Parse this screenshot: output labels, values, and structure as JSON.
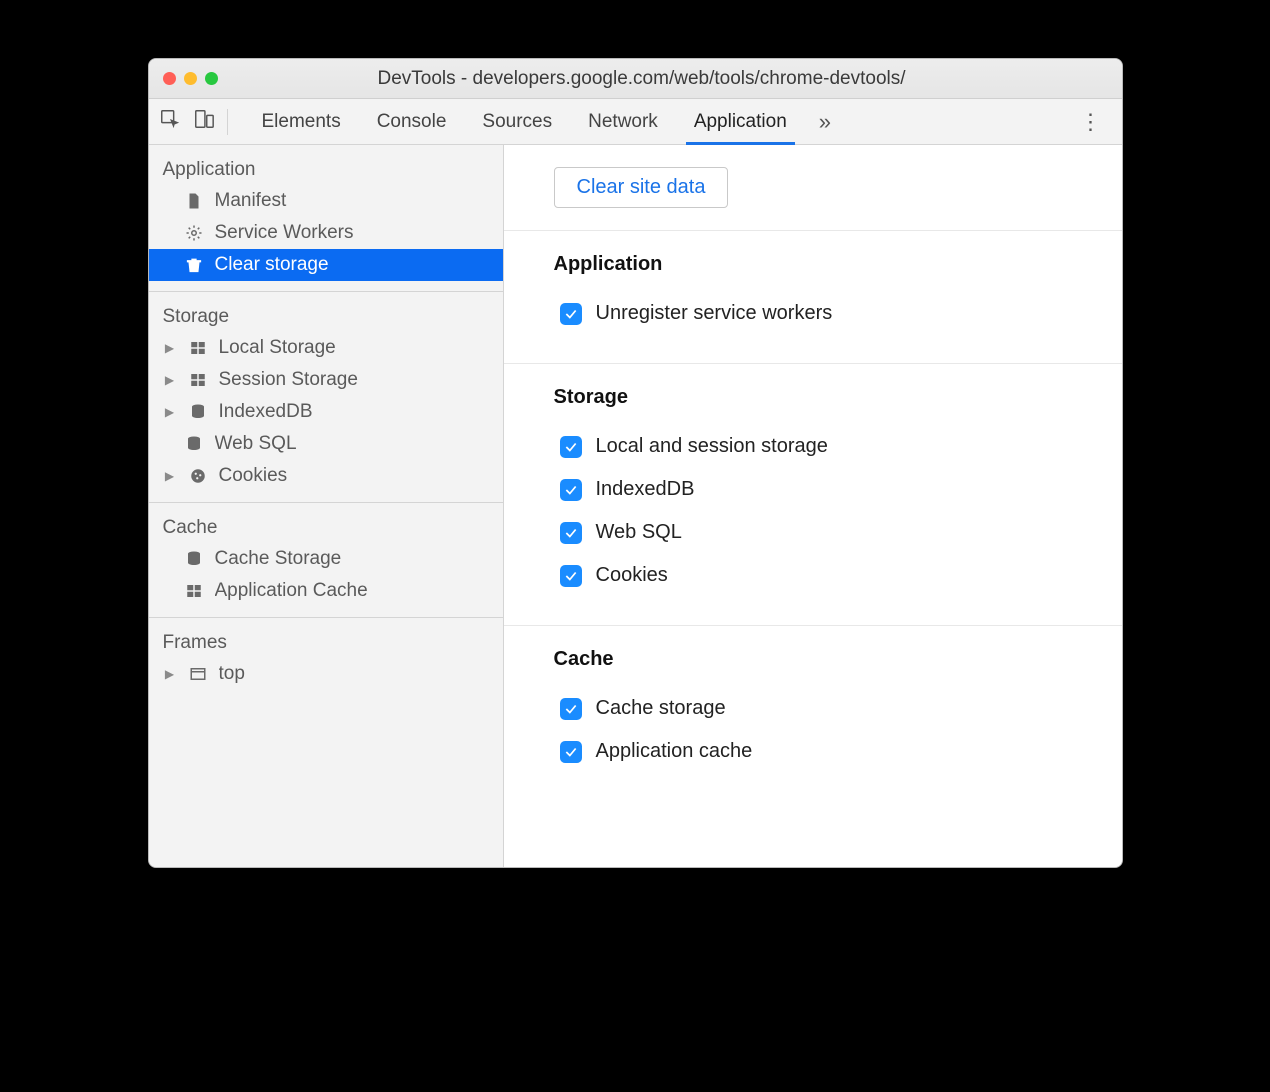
{
  "window": {
    "title": "DevTools - developers.google.com/web/tools/chrome-devtools/"
  },
  "toolbar": {
    "tabs": [
      "Elements",
      "Console",
      "Sources",
      "Network",
      "Application"
    ],
    "active_tab": "Application"
  },
  "sidebar": {
    "groups": [
      {
        "header": "Application",
        "items": [
          {
            "label": "Manifest",
            "icon": "file",
            "expandable": false,
            "selected": false
          },
          {
            "label": "Service Workers",
            "icon": "gear",
            "expandable": false,
            "selected": false
          },
          {
            "label": "Clear storage",
            "icon": "trash",
            "expandable": false,
            "selected": true
          }
        ]
      },
      {
        "header": "Storage",
        "items": [
          {
            "label": "Local Storage",
            "icon": "table",
            "expandable": true,
            "selected": false
          },
          {
            "label": "Session Storage",
            "icon": "table",
            "expandable": true,
            "selected": false
          },
          {
            "label": "IndexedDB",
            "icon": "db",
            "expandable": true,
            "selected": false
          },
          {
            "label": "Web SQL",
            "icon": "db",
            "expandable": false,
            "selected": false
          },
          {
            "label": "Cookies",
            "icon": "cookie",
            "expandable": true,
            "selected": false
          }
        ]
      },
      {
        "header": "Cache",
        "items": [
          {
            "label": "Cache Storage",
            "icon": "db",
            "expandable": false,
            "selected": false
          },
          {
            "label": "Application Cache",
            "icon": "table",
            "expandable": false,
            "selected": false
          }
        ]
      },
      {
        "header": "Frames",
        "items": [
          {
            "label": "top",
            "icon": "frame",
            "expandable": true,
            "selected": false
          }
        ]
      }
    ]
  },
  "content": {
    "clear_button": "Clear site data",
    "sections": [
      {
        "title": "Application",
        "checks": [
          {
            "label": "Unregister service workers",
            "checked": true
          }
        ]
      },
      {
        "title": "Storage",
        "checks": [
          {
            "label": "Local and session storage",
            "checked": true
          },
          {
            "label": "IndexedDB",
            "checked": true
          },
          {
            "label": "Web SQL",
            "checked": true
          },
          {
            "label": "Cookies",
            "checked": true
          }
        ]
      },
      {
        "title": "Cache",
        "checks": [
          {
            "label": "Cache storage",
            "checked": true
          },
          {
            "label": "Application cache",
            "checked": true
          }
        ]
      }
    ]
  }
}
